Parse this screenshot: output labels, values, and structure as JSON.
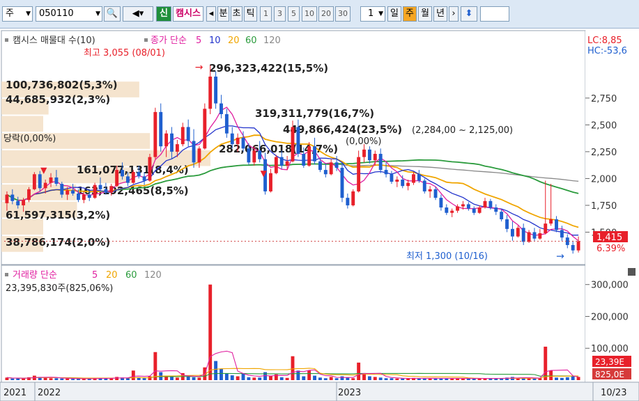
{
  "toolbar": {
    "market": "주",
    "code": "050110",
    "new_label": "신",
    "name": "캠시스",
    "period_units": [
      "분",
      "초",
      "틱"
    ],
    "numbers": [
      "1",
      "3",
      "5",
      "10",
      "20",
      "30"
    ],
    "count_value": "1",
    "day": "일",
    "week": "주",
    "month": "월",
    "year": "년"
  },
  "colors": {
    "up": "#e8202a",
    "down": "#1f5fcf",
    "ma5": "#e01fa0",
    "ma10": "#2233cc",
    "ma20": "#f0a500",
    "ma60": "#2a9b3c",
    "ma120": "#888888",
    "box": "#f3dfc6"
  },
  "chart_data": {
    "type": "candlestick",
    "price_legend": {
      "name": "캠시스 매물대 수(10)",
      "ma_label": "종가 단순",
      "periods": [
        "5",
        "10",
        "20",
        "60",
        "120"
      ]
    },
    "volume_legend": {
      "name": "거래량 단순",
      "periods": [
        "5",
        "20",
        "60",
        "120"
      ]
    },
    "price_ticks": [
      "2,750",
      "2,500",
      "2,250",
      "2,000",
      "1,750",
      "1,500"
    ],
    "volume_ticks": [
      "300,000",
      "200,000",
      "100,000"
    ],
    "x_labels": [
      "2021",
      "2022",
      "2023",
      "10/23"
    ],
    "right_info": {
      "lc": "LC:8,85",
      "hc": "HC:-53,6",
      "price": "1,415",
      "pct": "6.39%",
      "vol_now": "23,39E",
      "vol_ma": "825,0E"
    },
    "annotations": {
      "high": "최고 3,055 (08/01)",
      "low": "최저 1,300 (10/16)",
      "fall": "당락(0,00%)",
      "volume_note": "23,395,830주(825,06%)",
      "range": "(2,284,00 ~ 2,125,00)",
      "mid_range": "(0,00%)"
    },
    "profile_labels": [
      "296,323,422(15,5%)",
      "100,736,802(5,3%)",
      "44,685,932(2,3%)",
      "319,311,779(16,7%)",
      "449,866,424(23,5%)",
      "282,066,018(14,7%)",
      "161,077,131(8,4%)",
      "163,192,465(8,5%)",
      "61,597,315(3,2%)",
      "38,786,174(2,0%)"
    ],
    "profile": [
      {
        "low": 2750,
        "high": 2910,
        "fraction": 0.155
      },
      {
        "low": 2590,
        "high": 2750,
        "fraction": 0.053
      },
      {
        "low": 2430,
        "high": 2590,
        "fraction": 0.023
      },
      {
        "low": 2270,
        "high": 2430,
        "fraction": 0.167
      },
      {
        "low": 2110,
        "high": 2270,
        "fraction": 0.235
      },
      {
        "low": 1950,
        "high": 2110,
        "fraction": 0.147
      },
      {
        "low": 1790,
        "high": 1950,
        "fraction": 0.084
      },
      {
        "low": 1630,
        "high": 1790,
        "fraction": 0.085
      },
      {
        "low": 1470,
        "high": 1630,
        "fraction": 0.032
      },
      {
        "low": 1310,
        "high": 1470,
        "fraction": 0.02
      }
    ],
    "price_range": [
      1300,
      3055
    ],
    "last_price": 1415,
    "candles": [
      [
        1770,
        1880,
        1700,
        1850
      ],
      [
        1850,
        1900,
        1760,
        1790
      ],
      [
        1790,
        1830,
        1720,
        1750
      ],
      [
        1750,
        1820,
        1690,
        1800
      ],
      [
        1800,
        1920,
        1780,
        1900
      ],
      [
        1900,
        2060,
        1890,
        2040
      ],
      [
        2040,
        2070,
        1880,
        1910
      ],
      [
        1910,
        1990,
        1860,
        1960
      ],
      [
        1960,
        2050,
        1920,
        2010
      ],
      [
        2010,
        2080,
        1930,
        1950
      ],
      [
        1950,
        1970,
        1820,
        1850
      ],
      [
        1850,
        1920,
        1800,
        1890
      ],
      [
        1890,
        1950,
        1840,
        1860
      ],
      [
        1860,
        1900,
        1780,
        1800
      ],
      [
        1800,
        1880,
        1770,
        1850
      ],
      [
        1850,
        1900,
        1790,
        1820
      ],
      [
        1820,
        1960,
        1810,
        1940
      ],
      [
        1940,
        2010,
        1880,
        1900
      ],
      [
        1900,
        1960,
        1850,
        1870
      ],
      [
        1870,
        1950,
        1840,
        1930
      ],
      [
        1930,
        2120,
        1920,
        2080
      ],
      [
        2080,
        2150,
        1990,
        2020
      ],
      [
        2020,
        2060,
        1930,
        1960
      ],
      [
        1960,
        2080,
        1950,
        2060
      ],
      [
        2060,
        2120,
        2000,
        2020
      ],
      [
        2020,
        2060,
        1940,
        1980
      ],
      [
        1980,
        2230,
        1970,
        2200
      ],
      [
        2200,
        2660,
        2180,
        2620
      ],
      [
        2620,
        2700,
        2250,
        2300
      ],
      [
        2300,
        2450,
        2200,
        2420
      ],
      [
        2420,
        2480,
        2180,
        2250
      ],
      [
        2250,
        2360,
        2200,
        2320
      ],
      [
        2320,
        2520,
        2300,
        2480
      ],
      [
        2480,
        2550,
        2300,
        2350
      ],
      [
        2350,
        2460,
        2100,
        2150
      ],
      [
        2150,
        2300,
        2100,
        2280
      ],
      [
        2280,
        2700,
        2270,
        2650
      ],
      [
        2650,
        3055,
        2600,
        2950
      ],
      [
        2950,
        3000,
        2650,
        2700
      ],
      [
        2700,
        2780,
        2560,
        2600
      ],
      [
        2600,
        2650,
        2380,
        2420
      ],
      [
        2420,
        2480,
        2280,
        2320
      ],
      [
        2320,
        2420,
        2250,
        2380
      ],
      [
        2380,
        2440,
        2250,
        2280
      ],
      [
        2280,
        2330,
        2130,
        2150
      ],
      [
        2150,
        2300,
        2120,
        2260
      ],
      [
        2260,
        2350,
        2150,
        2180
      ],
      [
        2180,
        2240,
        1850,
        1880
      ],
      [
        1880,
        2090,
        1870,
        2050
      ],
      [
        2050,
        2220,
        2040,
        2200
      ],
      [
        2200,
        2260,
        2090,
        2120
      ],
      [
        2120,
        2210,
        2080,
        2160
      ],
      [
        2160,
        2540,
        2150,
        2480
      ],
      [
        2480,
        2550,
        2200,
        2230
      ],
      [
        2230,
        2290,
        2100,
        2120
      ],
      [
        2120,
        2340,
        2110,
        2300
      ],
      [
        2300,
        2380,
        2130,
        2160
      ],
      [
        2160,
        2190,
        2060,
        2080
      ],
      [
        2080,
        2140,
        2010,
        2040
      ],
      [
        2040,
        2180,
        2030,
        2150
      ],
      [
        2150,
        2210,
        2070,
        2100
      ],
      [
        2100,
        2140,
        1780,
        1820
      ],
      [
        1820,
        1860,
        1720,
        1750
      ],
      [
        1750,
        1900,
        1740,
        1880
      ],
      [
        1880,
        2260,
        1870,
        2200
      ],
      [
        2200,
        2320,
        2150,
        2270
      ],
      [
        2270,
        2300,
        2140,
        2170
      ],
      [
        2170,
        2260,
        2120,
        2230
      ],
      [
        2230,
        2280,
        2050,
        2080
      ],
      [
        2080,
        2150,
        2010,
        2040
      ],
      [
        2040,
        2070,
        1950,
        1970
      ],
      [
        1970,
        2020,
        1920,
        1990
      ],
      [
        1990,
        2030,
        1910,
        1930
      ],
      [
        1930,
        1990,
        1890,
        1960
      ],
      [
        1960,
        2060,
        1940,
        2040
      ],
      [
        2040,
        2080,
        1960,
        1980
      ],
      [
        1980,
        2000,
        1860,
        1880
      ],
      [
        1880,
        1930,
        1820,
        1900
      ],
      [
        1900,
        1920,
        1800,
        1820
      ],
      [
        1820,
        1850,
        1700,
        1730
      ],
      [
        1730,
        1760,
        1660,
        1680
      ],
      [
        1680,
        1720,
        1640,
        1700
      ],
      [
        1700,
        1760,
        1680,
        1740
      ],
      [
        1740,
        1790,
        1710,
        1760
      ],
      [
        1760,
        1780,
        1700,
        1720
      ],
      [
        1720,
        1740,
        1660,
        1680
      ],
      [
        1680,
        1750,
        1670,
        1730
      ],
      [
        1730,
        1820,
        1720,
        1790
      ],
      [
        1790,
        1810,
        1710,
        1730
      ],
      [
        1730,
        1760,
        1660,
        1690
      ],
      [
        1690,
        1720,
        1600,
        1620
      ],
      [
        1620,
        1660,
        1500,
        1530
      ],
      [
        1530,
        1600,
        1420,
        1460
      ],
      [
        1460,
        1560,
        1450,
        1540
      ],
      [
        1540,
        1580,
        1380,
        1410
      ],
      [
        1410,
        1520,
        1400,
        1500
      ],
      [
        1500,
        1540,
        1420,
        1440
      ],
      [
        1440,
        1530,
        1430,
        1490
      ],
      [
        1490,
        1980,
        1480,
        1580
      ],
      [
        1580,
        1950,
        1560,
        1620
      ],
      [
        1620,
        1650,
        1500,
        1520
      ],
      [
        1520,
        1560,
        1420,
        1450
      ],
      [
        1450,
        1480,
        1350,
        1380
      ],
      [
        1380,
        1420,
        1300,
        1330
      ],
      [
        1330,
        1460,
        1310,
        1415
      ]
    ],
    "volumes": [
      8,
      5,
      6,
      5,
      9,
      14,
      10,
      7,
      6,
      6,
      5,
      5,
      4,
      4,
      5,
      4,
      7,
      6,
      5,
      6,
      10,
      8,
      6,
      30,
      9,
      6,
      12,
      88,
      25,
      14,
      10,
      8,
      22,
      12,
      9,
      8,
      40,
      300,
      60,
      35,
      20,
      15,
      12,
      22,
      9,
      8,
      8,
      25,
      14,
      18,
      9,
      7,
      75,
      30,
      12,
      30,
      14,
      8,
      6,
      10,
      6,
      12,
      8,
      6,
      55,
      22,
      12,
      10,
      8,
      6,
      6,
      5,
      5,
      5,
      7,
      5,
      6,
      5,
      5,
      6,
      5,
      5,
      5,
      5,
      5,
      5,
      5,
      6,
      5,
      5,
      6,
      8,
      10,
      6,
      8,
      6,
      5,
      6,
      105,
      30,
      8,
      7,
      9,
      14,
      10
    ]
  }
}
